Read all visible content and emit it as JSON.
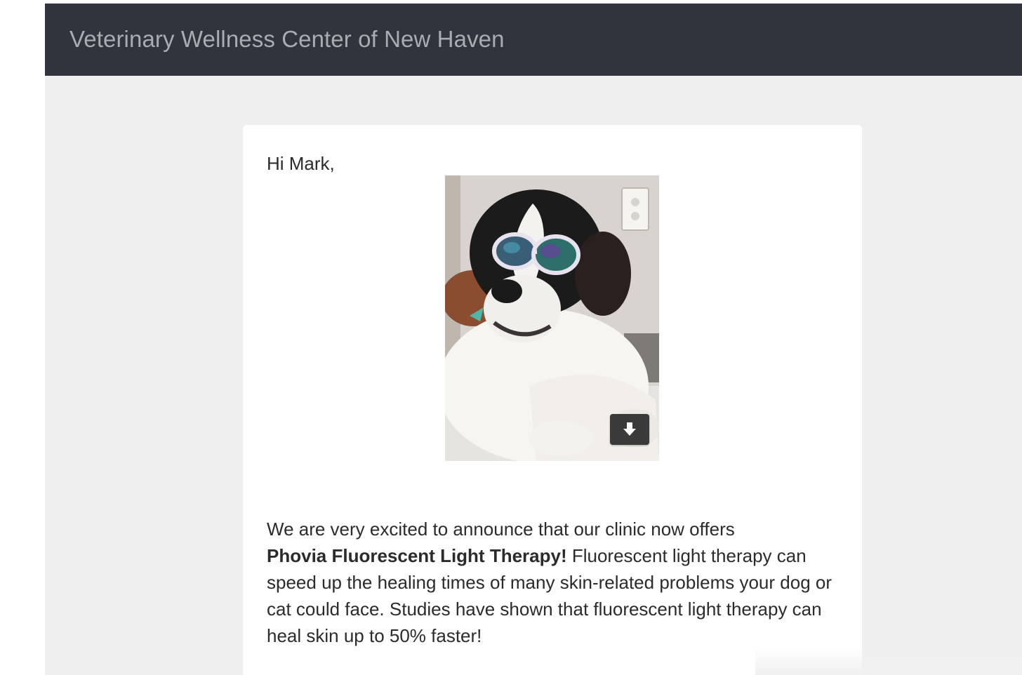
{
  "header": {
    "title": "Veterinary Wellness Center of New Haven"
  },
  "email": {
    "greeting": "Hi Mark,",
    "image": {
      "alt": "Dog wearing goggles",
      "download_icon": "download-arrow-icon"
    },
    "body": {
      "intro": "We are very excited to announce that our clinic now offers",
      "highlight": "Phovia Fluorescent Light Therapy!",
      "rest": " Fluorescent light therapy can speed up the healing times of many skin-related problems your dog or cat could face. Studies have shown that fluorescent light therapy can heal skin up to 50% faster!"
    }
  },
  "colors": {
    "header_bg": "#2f343d",
    "header_text": "#a9acb1",
    "page_bg": "#efefef",
    "card_bg": "#ffffff",
    "text": "#2b2b2b"
  }
}
